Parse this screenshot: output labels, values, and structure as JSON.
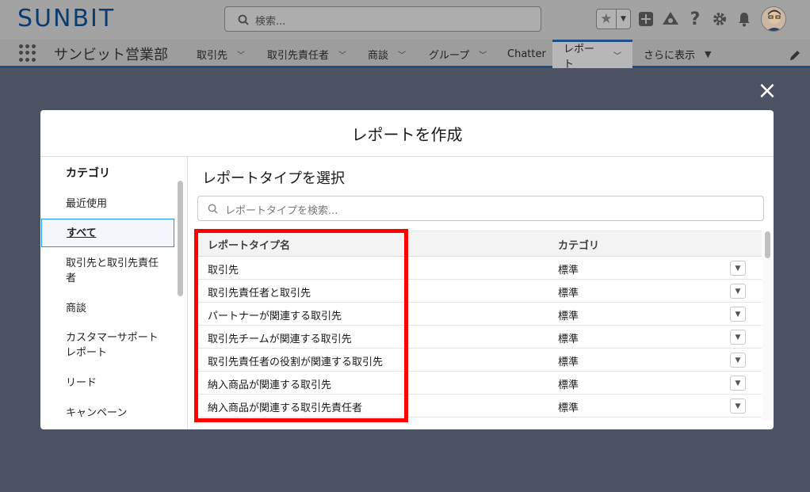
{
  "header": {
    "logo_text": "SUNBIT",
    "search_placeholder": "検索...",
    "icons": [
      "star-icon",
      "chevron-down-icon",
      "add-icon",
      "trailhead-icon",
      "help-icon",
      "gear-icon",
      "bell-icon",
      "avatar"
    ]
  },
  "nav": {
    "app_name": "サンビット営業部",
    "tabs": [
      {
        "label": "取引先"
      },
      {
        "label": "取引先責任者"
      },
      {
        "label": "商談"
      },
      {
        "label": "グループ"
      },
      {
        "label": "Chatter"
      },
      {
        "label": "レポート",
        "active": true
      },
      {
        "label": "さらに表示"
      }
    ]
  },
  "modal": {
    "title": "レポートを作成",
    "close_label": "×",
    "sidebar": {
      "title": "カテゴリ",
      "items": [
        {
          "label": "最近使用"
        },
        {
          "label": "すべて",
          "selected": true
        },
        {
          "label": "取引先と取引先責任者"
        },
        {
          "label": "商談"
        },
        {
          "label": "カスタマーサポートレポート"
        },
        {
          "label": "リード"
        },
        {
          "label": "キャンペーン"
        }
      ]
    },
    "main": {
      "title": "レポートタイプを選択",
      "search_placeholder": "レポートタイプを検索...",
      "columns": [
        "レポートタイプ名",
        "カテゴリ"
      ],
      "rows": [
        {
          "name": "取引先",
          "category": "標準"
        },
        {
          "name": "取引先責任者と取引先",
          "category": "標準"
        },
        {
          "name": "パートナーが関連する取引先",
          "category": "標準"
        },
        {
          "name": "取引先チームが関連する取引先",
          "category": "標準"
        },
        {
          "name": "取引先責任者の役割が関連する取引先",
          "category": "標準"
        },
        {
          "name": "納入商品が関連する取引先",
          "category": "標準"
        },
        {
          "name": "納入商品が関連する取引先責任者",
          "category": "標準"
        }
      ]
    }
  },
  "colors": {
    "overlay": "#4b5261",
    "brand_blue": "#1f4f86",
    "selection_border": "#1b96ff",
    "annotation_red": "#ff0000"
  }
}
